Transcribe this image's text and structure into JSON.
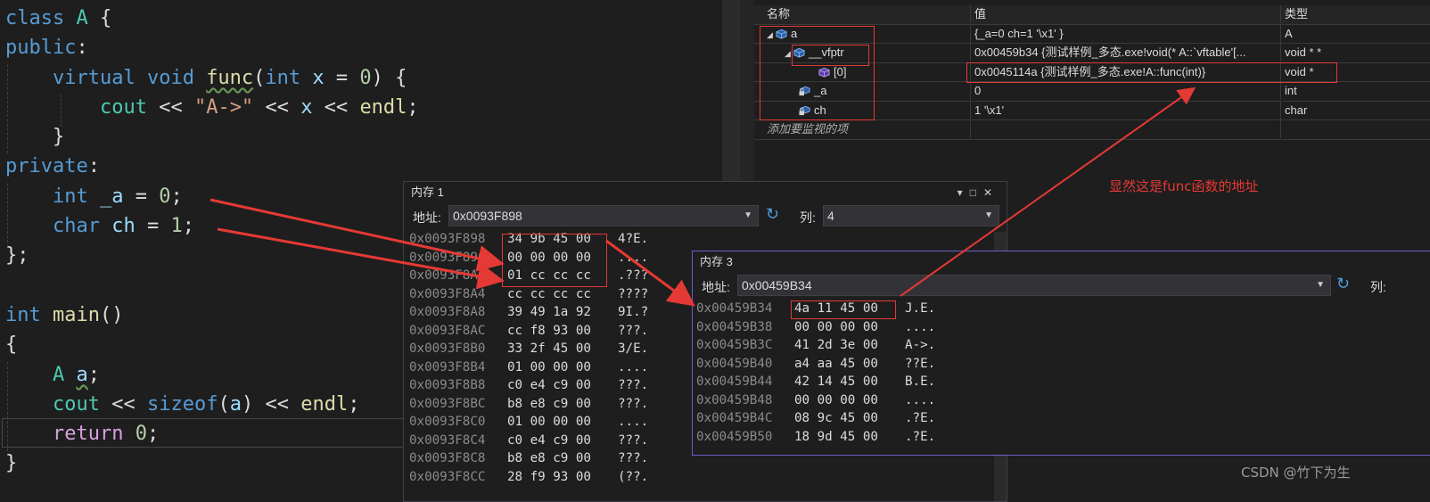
{
  "code": {
    "line1": {
      "kw": "class",
      "name": "A",
      "brace": "{"
    },
    "line2": {
      "kw": "public",
      "colon": ":"
    },
    "line3": {
      "kw1": "virtual",
      "kw2": "void",
      "fn": "func",
      "paren_open": "(",
      "kw3": "int",
      "param": "x",
      "eq": "=",
      "num": "0",
      "tail": ") {"
    },
    "line4": {
      "obj": "cout",
      "op": "<<",
      "str": "\"A->\"",
      "op2": "<<",
      "var": "x",
      "op3": "<<",
      "endl": "endl",
      "semi": ";"
    },
    "line5": {
      "brace": "}"
    },
    "line6": {
      "kw": "private",
      "colon": ":"
    },
    "line7": {
      "kw": "int",
      "var": "_a",
      "eq": "=",
      "num": "0",
      "semi": ";"
    },
    "line8": {
      "kw": "char",
      "var": "ch",
      "eq": "=",
      "num": "1",
      "semi": ";"
    },
    "line9": {
      "text": "};"
    },
    "line11": {
      "kw": "int",
      "fn": "main",
      "paren": "()"
    },
    "line12": {
      "brace": "{"
    },
    "line13": {
      "type": "A",
      "var": "a",
      "semi": ";"
    },
    "line14": {
      "obj": "cout",
      "op": "<<",
      "kw": "sizeof",
      "paren_open": "(",
      "arg": "a",
      "paren_close": ")",
      "op2": "<<",
      "endl": "endl",
      "semi": ";"
    },
    "line15": {
      "kw": "return",
      "num": "0",
      "semi": ";"
    },
    "line16": {
      "brace": "}"
    }
  },
  "watch": {
    "headers": {
      "name": "名称",
      "value": "值",
      "type": "类型"
    },
    "rows": [
      {
        "name": "a",
        "value": "{_a=0 ch=1 '\\x1' }",
        "type": "A"
      },
      {
        "name": "__vfptr",
        "value": "0x00459b34 {测试样例_多态.exe!void(* A::`vftable'[...",
        "type": "void * *"
      },
      {
        "name": "[0]",
        "value": "0x0045114a {测试样例_多态.exe!A::func(int)}",
        "type": "void *"
      },
      {
        "name": "_a",
        "value": "0",
        "type": "int"
      },
      {
        "name": "ch",
        "value": "1 '\\x1'",
        "type": "char"
      }
    ],
    "add_placeholder": "添加要监视的项"
  },
  "memory1": {
    "title": "内存 1",
    "address_label": "地址:",
    "address": "0x0093F898",
    "columns_label": "列:",
    "columns": "4",
    "rows": [
      {
        "addr": "0x0093F898",
        "bytes": "34 9b 45 00",
        "text": "4?E."
      },
      {
        "addr": "0x0093F89C",
        "bytes": "00 00 00 00",
        "text": "...."
      },
      {
        "addr": "0x0093F8A0",
        "bytes": "01 cc cc cc",
        "text": ".???"
      },
      {
        "addr": "0x0093F8A4",
        "bytes": "cc cc cc cc",
        "text": "????"
      },
      {
        "addr": "0x0093F8A8",
        "bytes": "39 49 1a 92",
        "text": "9I.?"
      },
      {
        "addr": "0x0093F8AC",
        "bytes": "cc f8 93 00",
        "text": "???."
      },
      {
        "addr": "0x0093F8B0",
        "bytes": "33 2f 45 00",
        "text": "3/E."
      },
      {
        "addr": "0x0093F8B4",
        "bytes": "01 00 00 00",
        "text": "...."
      },
      {
        "addr": "0x0093F8B8",
        "bytes": "c0 e4 c9 00",
        "text": "???."
      },
      {
        "addr": "0x0093F8BC",
        "bytes": "b8 e8 c9 00",
        "text": "???."
      },
      {
        "addr": "0x0093F8C0",
        "bytes": "01 00 00 00",
        "text": "...."
      },
      {
        "addr": "0x0093F8C4",
        "bytes": "c0 e4 c9 00",
        "text": "???."
      },
      {
        "addr": "0x0093F8C8",
        "bytes": "b8 e8 c9 00",
        "text": "???."
      },
      {
        "addr": "0x0093F8CC",
        "bytes": "28 f9 93 00",
        "text": "(??."
      }
    ]
  },
  "memory3": {
    "title": "内存 3",
    "address_label": "地址:",
    "address": "0x00459B34",
    "columns_label": "列:",
    "rows": [
      {
        "addr": "0x00459B34",
        "bytes": "4a 11 45 00",
        "text": "J.E."
      },
      {
        "addr": "0x00459B38",
        "bytes": "00 00 00 00",
        "text": "...."
      },
      {
        "addr": "0x00459B3C",
        "bytes": "41 2d 3e 00",
        "text": "A->."
      },
      {
        "addr": "0x00459B40",
        "bytes": "a4 aa 45 00",
        "text": "??E."
      },
      {
        "addr": "0x00459B44",
        "bytes": "42 14 45 00",
        "text": "B.E."
      },
      {
        "addr": "0x00459B48",
        "bytes": "00 00 00 00",
        "text": "...."
      },
      {
        "addr": "0x00459B4C",
        "bytes": "08 9c 45 00",
        "text": ".?E."
      },
      {
        "addr": "0x00459B50",
        "bytes": "18 9d 45 00",
        "text": ".?E."
      }
    ]
  },
  "annotation": "显然这是func函数的地址",
  "watermark": "CSDN @竹下为生",
  "colors": {
    "annotation": "#e53935",
    "keyword": "#569cd6",
    "function": "#dcdcaa",
    "string": "#d69d85",
    "number": "#b5cea8",
    "mem3_border": "#6f5cc7"
  }
}
